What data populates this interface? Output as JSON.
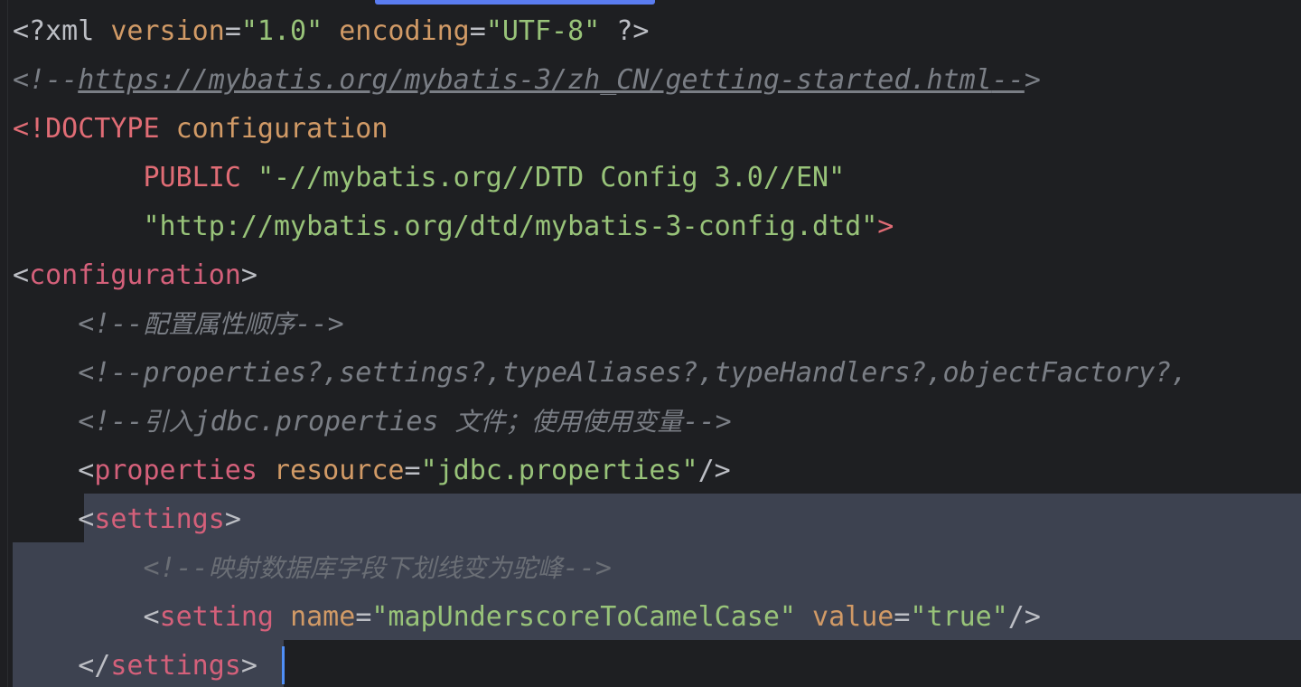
{
  "editor": {
    "lines": [
      {
        "id": "xml-decl",
        "parts": [
          {
            "t": "<?xml ",
            "c": "c-punc"
          },
          {
            "t": "version",
            "c": "c-attr"
          },
          {
            "t": "=",
            "c": "c-punc"
          },
          {
            "t": "\"1.0\"",
            "c": "c-str"
          },
          {
            "t": " ",
            "c": "c-punc"
          },
          {
            "t": "encoding",
            "c": "c-attr"
          },
          {
            "t": "=",
            "c": "c-punc"
          },
          {
            "t": "\"UTF-8\"",
            "c": "c-str"
          },
          {
            "t": " ?>",
            "c": "c-punc"
          }
        ]
      },
      {
        "id": "url-comment",
        "parts": [
          {
            "t": "<!--",
            "c": "c-comment"
          },
          {
            "t": "https://mybatis.org/mybatis-3/zh_CN/getting-started.html",
            "c": "c-comment c-link"
          },
          {
            "t": "--",
            "c": "c-comment c-link"
          },
          {
            "t": ">",
            "c": "c-comment"
          }
        ]
      },
      {
        "id": "doctype",
        "parts": [
          {
            "t": "<!DOCTYPE ",
            "c": "c-tag"
          },
          {
            "t": "configuration",
            "c": "c-doctype-name"
          }
        ]
      },
      {
        "id": "doctype-public",
        "parts": [
          {
            "t": "        ",
            "c": "c-punc"
          },
          {
            "t": "PUBLIC",
            "c": "c-kw"
          },
          {
            "t": " ",
            "c": "c-punc"
          },
          {
            "t": "\"-//mybatis.org//DTD Config 3.0//EN\"",
            "c": "c-str"
          }
        ]
      },
      {
        "id": "doctype-dtd",
        "parts": [
          {
            "t": "        ",
            "c": "c-punc"
          },
          {
            "t": "\"http://mybatis.org/dtd/mybatis-3-config.dtd\"",
            "c": "c-str"
          },
          {
            "t": ">",
            "c": "c-tag"
          }
        ]
      },
      {
        "id": "config-open",
        "parts": [
          {
            "t": "<",
            "c": "c-punc"
          },
          {
            "t": "configuration",
            "c": "c-tag2"
          },
          {
            "t": ">",
            "c": "c-punc"
          }
        ]
      },
      {
        "id": "comment-order",
        "parts": [
          {
            "t": "    ",
            "c": "c-punc"
          },
          {
            "t": "<!--",
            "c": "c-comment"
          },
          {
            "t": "配置属性顺序",
            "c": "c-comment cjk"
          },
          {
            "t": "-->",
            "c": "c-comment"
          }
        ]
      },
      {
        "id": "comment-props",
        "parts": [
          {
            "t": "    ",
            "c": "c-punc"
          },
          {
            "t": "<!--properties?,settings?,typeAliases?,typeHandlers?,objectFactory?,",
            "c": "c-comment"
          }
        ]
      },
      {
        "id": "comment-jdbc",
        "parts": [
          {
            "t": "    ",
            "c": "c-punc"
          },
          {
            "t": "<!--",
            "c": "c-comment"
          },
          {
            "t": "引入",
            "c": "c-comment cjk"
          },
          {
            "t": "jdbc.properties ",
            "c": "c-comment"
          },
          {
            "t": "文件；使用使用变量",
            "c": "c-comment cjk"
          },
          {
            "t": "-->",
            "c": "c-comment"
          }
        ]
      },
      {
        "id": "properties-tag",
        "parts": [
          {
            "t": "    ",
            "c": "c-punc"
          },
          {
            "t": "<",
            "c": "c-punc"
          },
          {
            "t": "properties",
            "c": "c-tag2"
          },
          {
            "t": " ",
            "c": "c-punc"
          },
          {
            "t": "resource",
            "c": "c-attr"
          },
          {
            "t": "=",
            "c": "c-punc"
          },
          {
            "t": "\"jdbc.properties\"",
            "c": "c-str"
          },
          {
            "t": "/>",
            "c": "c-punc"
          }
        ]
      },
      {
        "id": "settings-open",
        "parts": [
          {
            "t": "    ",
            "c": "c-punc"
          },
          {
            "t": "<",
            "c": "c-punc"
          },
          {
            "t": "settings",
            "c": "c-tag2"
          },
          {
            "t": ">",
            "c": "c-punc"
          }
        ]
      },
      {
        "id": "comment-camel",
        "parts": [
          {
            "t": "        ",
            "c": "c-punc"
          },
          {
            "t": "<!--",
            "c": "c-comment-dim"
          },
          {
            "t": "映射数据库字段下划线变为驼峰",
            "c": "c-comment-dim cjk"
          },
          {
            "t": "-->",
            "c": "c-comment-dim"
          }
        ]
      },
      {
        "id": "setting-tag",
        "parts": [
          {
            "t": "        ",
            "c": "c-punc"
          },
          {
            "t": "<",
            "c": "c-punc"
          },
          {
            "t": "setting",
            "c": "c-tag2"
          },
          {
            "t": " ",
            "c": "c-punc"
          },
          {
            "t": "name",
            "c": "c-attr"
          },
          {
            "t": "=",
            "c": "c-punc"
          },
          {
            "t": "\"mapUnderscoreToCamelCase\"",
            "c": "c-str"
          },
          {
            "t": " ",
            "c": "c-punc"
          },
          {
            "t": "value",
            "c": "c-attr"
          },
          {
            "t": "=",
            "c": "c-punc"
          },
          {
            "t": "\"true\"",
            "c": "c-str"
          },
          {
            "t": "/>",
            "c": "c-punc"
          }
        ]
      },
      {
        "id": "settings-close",
        "parts": [
          {
            "t": "    ",
            "c": "c-punc"
          },
          {
            "t": "</",
            "c": "c-punc"
          },
          {
            "t": "settings",
            "c": "c-tag2"
          },
          {
            "t": ">",
            "c": "c-punc"
          }
        ]
      }
    ]
  }
}
